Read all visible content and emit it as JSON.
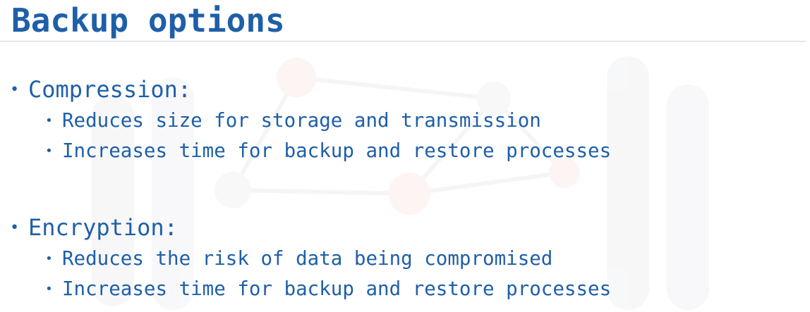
{
  "slide": {
    "title": "Backup options",
    "sections": [
      {
        "heading": "Compression:",
        "points": [
          "Reduces size for storage and transmission",
          "Increases time for backup and restore processes"
        ]
      },
      {
        "heading": "Encryption:",
        "points": [
          "Reduces the risk of data being compromised",
          "Increases time for backup and restore processes"
        ]
      }
    ],
    "bullet_glyph": "•"
  },
  "colors": {
    "text": "#1f5fa8",
    "rule": "#c9d4e1",
    "watermark": "#f3f4f6",
    "watermark_accent": "#fbeeea"
  }
}
